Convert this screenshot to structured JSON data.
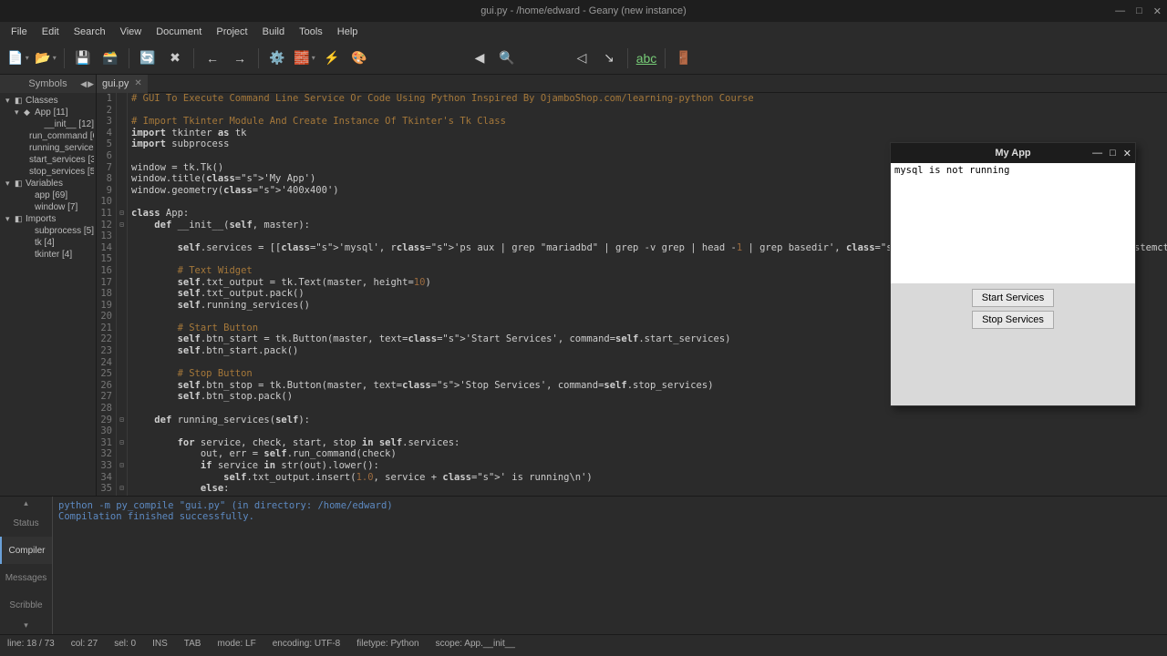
{
  "window": {
    "title": "gui.py - /home/edward - Geany (new instance)",
    "controls": {
      "min": "—",
      "max": "□",
      "close": "✕"
    }
  },
  "menubar": [
    "File",
    "Edit",
    "Search",
    "View",
    "Document",
    "Project",
    "Build",
    "Tools",
    "Help"
  ],
  "sidebar": {
    "title": "Symbols",
    "root_classes": "Classes",
    "nodes": [
      {
        "label": "App [11]",
        "indent": 1,
        "collapse": "▾",
        "icon": "◆"
      },
      {
        "label": "__init__ [12]",
        "indent": 2,
        "icon": ""
      },
      {
        "label": "run_command [6",
        "indent": 2,
        "icon": ""
      },
      {
        "label": "running_services",
        "indent": 2,
        "icon": ""
      },
      {
        "label": "start_services [38",
        "indent": 2,
        "icon": ""
      },
      {
        "label": "stop_services [52",
        "indent": 2,
        "icon": ""
      }
    ],
    "variables": "Variables",
    "var_nodes": [
      {
        "label": "app [69]",
        "indent": 1,
        "icon": ""
      },
      {
        "label": "window [7]",
        "indent": 1,
        "icon": ""
      }
    ],
    "imports": "Imports",
    "import_nodes": [
      {
        "label": "subprocess [5]",
        "indent": 1,
        "icon": ""
      },
      {
        "label": "tk [4]",
        "indent": 1,
        "icon": ""
      },
      {
        "label": "tkinter [4]",
        "indent": 1,
        "icon": ""
      }
    ]
  },
  "tab": {
    "label": "gui.py",
    "close": "✕"
  },
  "code_lines": [
    "# GUI To Execute Command Line Service Or Code Using Python Inspired By OjamboShop.com/learning-python Course",
    "",
    "# Import Tkinter Module And Create Instance Of Tkinter's Tk Class",
    "import tkinter as tk",
    "import subprocess",
    "",
    "window = tk.Tk()",
    "window.title('My App')",
    "window.geometry('400x400')",
    "",
    "class App:",
    "    def __init__(self, master):",
    "",
    "        self.services = [['mysql', r'ps aux | grep \"mariadbd\" | grep -v grep | head -1 | grep basedir', 'systemctl start mariadb', 'systemctl stop mariadb']]",
    "",
    "        # Text Widget",
    "        self.txt_output = tk.Text(master, height=10)",
    "        self.txt_output.pack()",
    "        self.running_services()",
    "",
    "        # Start Button",
    "        self.btn_start = tk.Button(master, text='Start Services', command=self.start_services)",
    "        self.btn_start.pack()",
    "",
    "        # Stop Button",
    "        self.btn_stop = tk.Button(master, text='Stop Services', command=self.stop_services)",
    "        self.btn_stop.pack()",
    "",
    "    def running_services(self):",
    "",
    "        for service, check, start, stop in self.services:",
    "            out, err = self.run_command(check)",
    "            if service in str(out).lower():",
    "                self.txt_output.insert(1.0, service + ' is running\\n')",
    "            else:"
  ],
  "fold_markers": {
    "11": "⊟",
    "12": "⊟",
    "29": "⊟",
    "31": "⊟",
    "33": "⊟",
    "35": "⊟"
  },
  "compiler": {
    "line1": "python -m py_compile \"gui.py\" (in directory: /home/edward)",
    "line2": "Compilation finished successfully."
  },
  "bottom_tabs": [
    "Status",
    "Compiler",
    "Messages",
    "Scribble"
  ],
  "bottom_active": "Compiler",
  "statusbar": {
    "line": "line: 18 / 73",
    "col": "col: 27",
    "sel": "sel: 0",
    "ins": "INS",
    "tab": "TAB",
    "mode": "mode: LF",
    "encoding": "encoding: UTF-8",
    "filetype": "filetype: Python",
    "scope": "scope: App.__init__"
  },
  "my_app": {
    "title": "My App",
    "text_output": "mysql is not running",
    "start_btn": "Start Services",
    "stop_btn": "Stop Services"
  },
  "chart_data": null
}
